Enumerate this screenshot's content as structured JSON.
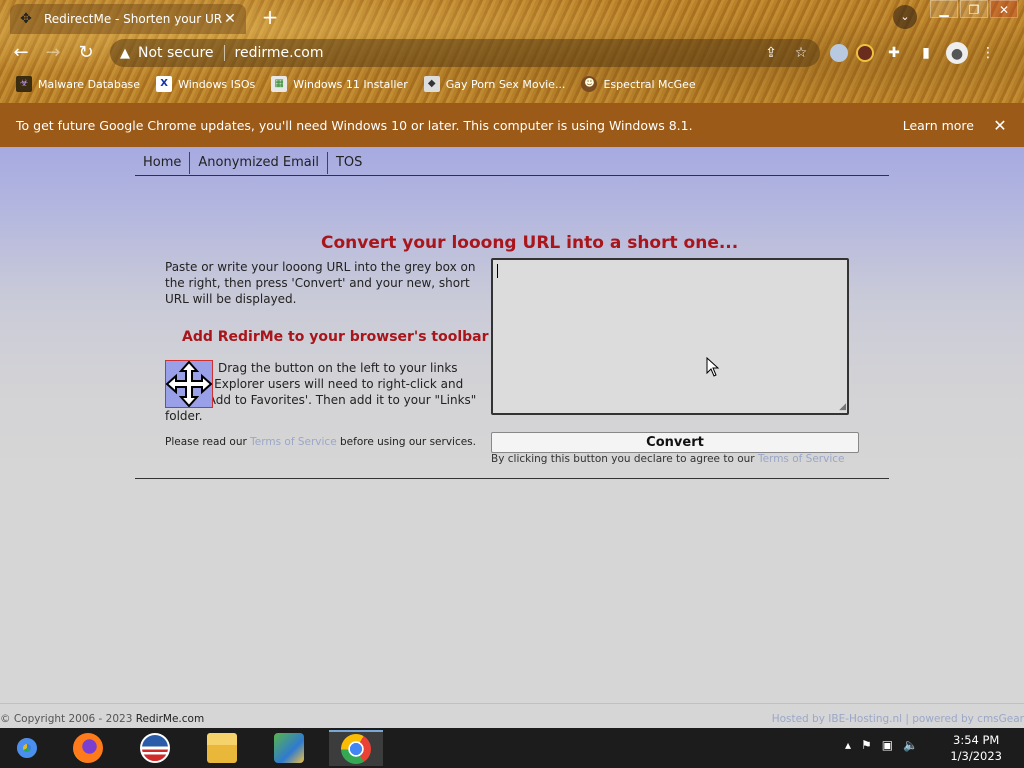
{
  "browser": {
    "tab_title": "RedirectMe - Shorten your URL !",
    "omnibox_warning": "Not secure",
    "url": "redirme.com",
    "bookmarks": [
      {
        "label": "Malware Database",
        "icon": "malware-icon"
      },
      {
        "label": "Windows ISOs",
        "icon": "x-icon"
      },
      {
        "label": "Windows 11 Installer",
        "icon": "installer-icon"
      },
      {
        "label": "Gay Porn Sex Movie...",
        "icon": "site-icon"
      },
      {
        "label": "Espectral McGee",
        "icon": "avatar-icon"
      }
    ]
  },
  "infobar": {
    "message": "To get future Google Chrome updates, you'll need Windows 10 or later. This computer is using Windows 8.1.",
    "learn_more": "Learn more"
  },
  "nav": {
    "items": [
      "Home",
      "Anonymized Email",
      "TOS"
    ]
  },
  "main": {
    "headline": "Convert your looong URL into a short one...",
    "intro": "Paste or write your looong URL into the grey box on the right, then press 'Convert' and your new, short URL will be displayed.",
    "toolbar_heading": "Add RedirMe to your browser's toolbar",
    "drag_text": "Drag the button on the left to your links toolbar. Explorer users will need to right-click and select 'Add to Favorites'. Then add it to your \"Links\" folder.",
    "terms_pre": "Please read our ",
    "terms_link": "Terms of Service",
    "terms_post": " before using our services.",
    "convert_label": "Convert",
    "convert_note_pre": "By clicking this button you declare to agree to our ",
    "convert_note_link": "Terms of Service"
  },
  "footer": {
    "copyright_pre": "© Copyright 2006 - 2023 ",
    "copyright_site": "RedirMe.com",
    "hosted": "Hosted by IBE-Hosting.nl  |  powered by cmsGear"
  },
  "taskbar": {
    "time": "3:54 PM",
    "date": "1/3/2023"
  },
  "colors": {
    "chrome_theme": "#b07a28",
    "infobar": "#9b5a17",
    "heading_red": "#a8151b",
    "link_blue": "#9aa7c8"
  }
}
